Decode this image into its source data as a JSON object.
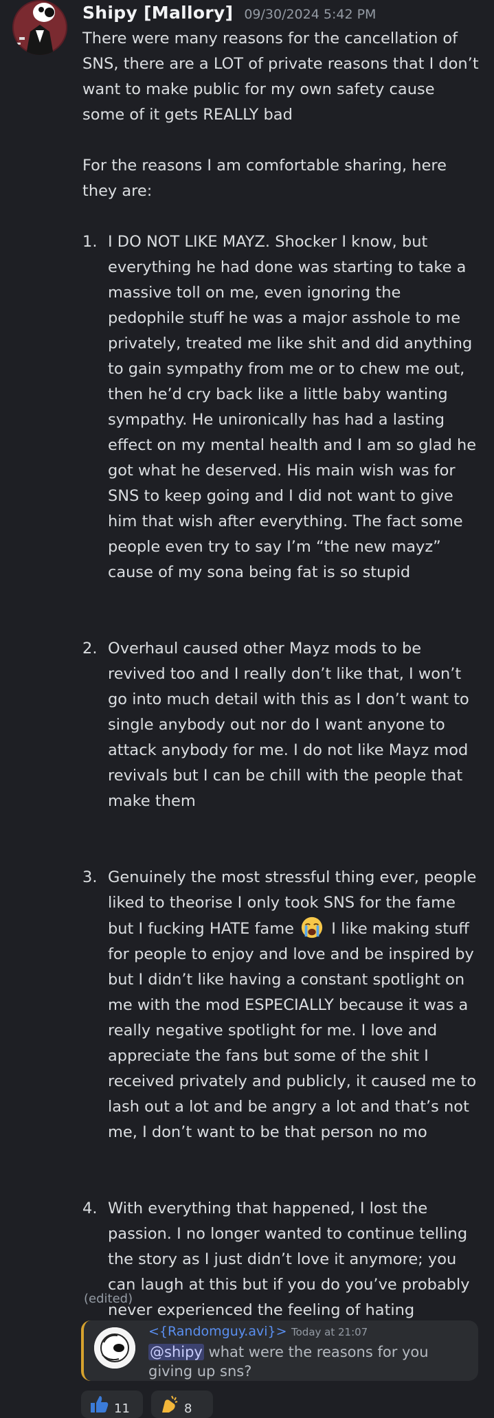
{
  "message": {
    "author": "Shipy [Mallory]",
    "timestamp": "09/30/2024 5:42 PM",
    "intro_1": "There were many reasons for the cancellation of SNS, there are a LOT of private reasons that I don’t want to make public for my own safety cause some of it gets REALLY bad",
    "intro_2": "For the reasons I am comfortable sharing, here they are:",
    "reasons": [
      {
        "number": "1.",
        "text": "I DO NOT LIKE MAYZ. Shocker I know, but everything he had done was starting to take a massive toll on me, even ignoring the pedophile stuff he was a major asshole to me privately, treated me like shit and did anything to gain sympathy from me or to chew me out, then he’d cry back like a little baby wanting sympathy. He unironically has had a lasting effect on my mental health and I am so glad he got what he deserved. His main wish was for SNS to keep going and I did not want to give him that wish after everything. The fact some people even try to say I’m “the new mayz” cause of my sona being fat is so stupid"
      },
      {
        "number": "2.",
        "text": "Overhaul caused other Mayz mods to be revived too and I really don’t like that, I won’t go into much detail with this as I don’t want to single anybody out nor do I want anyone to attack anybody for me. I do not like Mayz mod revivals but I can be chill with the people that make them"
      },
      {
        "number": "3.",
        "text_before_emoji": "Genuinely the most stressful thing ever, people liked to theorise I only took SNS for the fame but I fucking HATE fame",
        "emoji": "loudly-crying-face-emoji",
        "text_after_emoji": " I like making stuff for people to enjoy and love and be inspired by but I didn’t like having a constant spotlight on me with the mod ESPECIALLY because it was a really negative spotlight for me. I love and appreciate the fans but some of the shit I received privately and publicly, it caused me to lash out a lot and be angry a lot and that’s not me, I don’t want to be that person no mo"
      },
      {
        "number": "4.",
        "text": "With everything that happened, I lost the passion. I no longer wanted to continue telling the story as I just didn’t love it anymore; you can laugh at this but if you do you’ve probably never experienced the feeling of hating something you once loved to make, it’s a hard one."
      }
    ],
    "edited_label": "(edited)"
  },
  "reply": {
    "author": "<{Randomguy.avi}>",
    "timestamp": "Today at 21:07",
    "mention": "@shipy",
    "text": " what were the reasons for you giving up sns?"
  },
  "reactions": [
    {
      "icon": "thumbs-up-icon",
      "count": "11"
    },
    {
      "icon": "clapping-hands-icon",
      "count": "8"
    }
  ],
  "colors": {
    "background": "#1e1f24",
    "text": "#dbdee1",
    "muted": "#949ba4",
    "reply_name": "#5a8ff0",
    "mention_bg": "#3c4270",
    "reply_accent": "#d6a22e"
  }
}
